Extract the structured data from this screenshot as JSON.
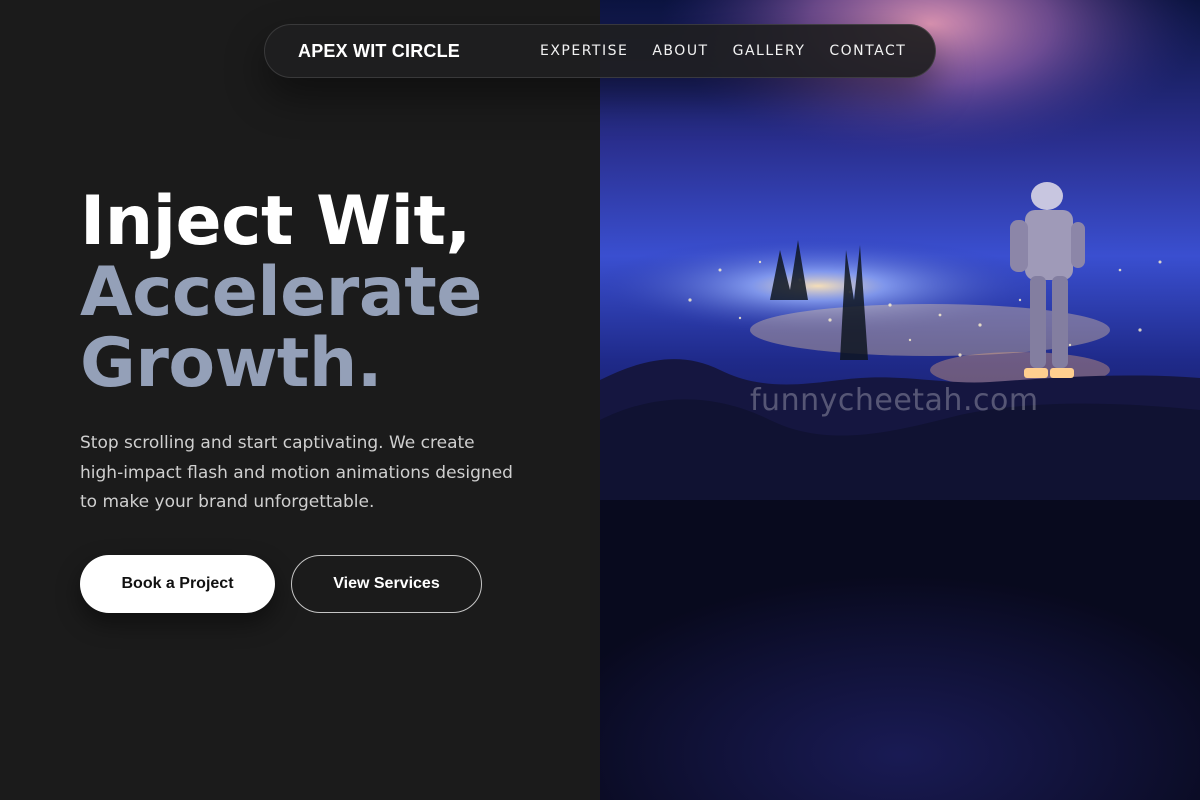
{
  "nav": {
    "brand": "APEX WIT CIRCLE",
    "links": [
      {
        "label": "EXPERTISE"
      },
      {
        "label": "ABOUT"
      },
      {
        "label": "GALLERY"
      },
      {
        "label": "CONTACT"
      }
    ]
  },
  "hero": {
    "headline_line1": "Inject Wit,",
    "headline_line2": "Accelerate",
    "headline_line3": "Growth.",
    "subtitle": "Stop scrolling and start captivating. We create high-impact flash and motion animations designed to make your brand unforgettable.",
    "primary_button": "Book a Project",
    "secondary_button": "View Services"
  },
  "image": {
    "description_icon": "astronaut-on-cliff-over-city-lights",
    "watermark": "funnycheetah.com"
  },
  "colors": {
    "background": "#1b1b1b",
    "headline_accent": "#94a0b8",
    "body_text": "#cfcfcf",
    "button_primary_bg": "#ffffff"
  }
}
